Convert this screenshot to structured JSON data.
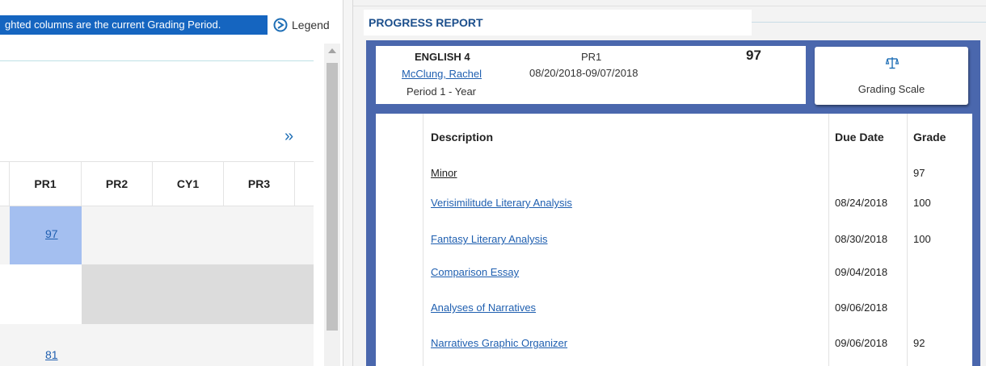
{
  "left": {
    "highlight_note": "ghted columns are the current Grading Period.",
    "legend_label": "Legend",
    "columns": [
      "PR1",
      "PR2",
      "CY1",
      "PR3"
    ],
    "grades": [
      "97",
      "81"
    ]
  },
  "right": {
    "title": "PROGRESS REPORT",
    "course": {
      "name": "ENGLISH 4",
      "teacher": "McClung, Rachel",
      "period": "Period 1 - Year",
      "term": "PR1",
      "dates": "08/20/2018-09/07/2018",
      "grade": "97"
    },
    "grading_scale_label": "Grading Scale",
    "table": {
      "headers": {
        "description": "Description",
        "due_date": "Due Date",
        "grade": "Grade"
      },
      "rows": [
        {
          "description": "Minor",
          "due": "",
          "grade": "97"
        },
        {
          "description": "Verisimilitude Literary Analysis",
          "due": "08/24/2018",
          "grade": "100"
        },
        {
          "description": "Fantasy Literary Analysis",
          "due": "08/30/2018",
          "grade": "100"
        },
        {
          "description": "Comparison Essay",
          "due": "09/04/2018",
          "grade": ""
        },
        {
          "description": "Analyses of Narratives",
          "due": "09/06/2018",
          "grade": ""
        },
        {
          "description": "Narratives Graphic Organizer",
          "due": "09/06/2018",
          "grade": "92"
        }
      ]
    }
  },
  "colors": {
    "highlight": "#1565c0",
    "current_period_cell": "#a4bff0",
    "frame_blue": "#4a67ad",
    "link_blue": "#1f5fb0",
    "title_blue": "#1c4f8c"
  }
}
